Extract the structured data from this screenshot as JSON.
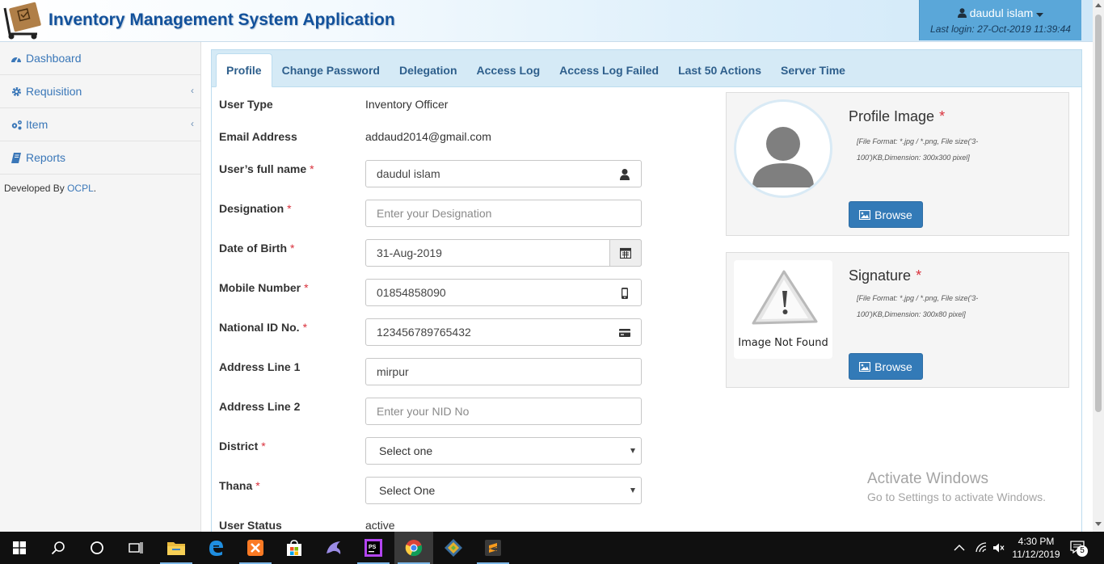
{
  "header": {
    "app_title": "Inventory Management System Application",
    "user_name": "daudul islam",
    "last_login": "Last login: 27-Oct-2019 11:39:44"
  },
  "sidebar": {
    "items": [
      {
        "label": "Dashboard",
        "icon": "dashboard-icon"
      },
      {
        "label": "Requisition",
        "icon": "gear-icon"
      },
      {
        "label": "Item",
        "icon": "gears-icon"
      },
      {
        "label": "Reports",
        "icon": "book-icon"
      }
    ],
    "developed_by_prefix": "Developed By",
    "developed_by_link": "OCPL",
    "developed_by_suffix": "."
  },
  "tabs": [
    {
      "label": "Profile",
      "active": true
    },
    {
      "label": "Change Password"
    },
    {
      "label": "Delegation"
    },
    {
      "label": "Access Log"
    },
    {
      "label": "Access Log Failed"
    },
    {
      "label": "Last 50 Actions"
    },
    {
      "label": "Server Time"
    }
  ],
  "form": {
    "user_type": {
      "label": "User Type",
      "value": "Inventory Officer"
    },
    "email": {
      "label": "Email Address",
      "value": "addaud2014@gmail.com"
    },
    "full_name": {
      "label": "User’s full name",
      "value": "daudul islam"
    },
    "designation": {
      "label": "Designation",
      "placeholder": "Enter your Designation"
    },
    "dob": {
      "label": "Date of Birth",
      "value": "31-Aug-2019"
    },
    "mobile": {
      "label": "Mobile Number",
      "value": "01854858090"
    },
    "nid": {
      "label": "National ID No.",
      "value": "123456789765432"
    },
    "address1": {
      "label": "Address Line 1",
      "value": "mirpur"
    },
    "address2": {
      "label": "Address Line 2",
      "placeholder": "Enter your NID No"
    },
    "district": {
      "label": "District",
      "selected": "Select one"
    },
    "thana": {
      "label": "Thana",
      "selected": "Select One"
    },
    "status": {
      "label": "User Status",
      "value": "active"
    },
    "required_mark": "*"
  },
  "profile_image": {
    "title": "Profile Image",
    "note": "[File Format: *.jpg / *.png, File size('3-100')KB,Dimension: 300x300 pixel]",
    "browse_label": "Browse"
  },
  "signature": {
    "title": "Signature",
    "note": "[File Format: *.jpg / *.png, File size('3-100')KB,Dimension: 300x80 pixel]",
    "browse_label": "Browse",
    "placeholder_text": "Image Not Found"
  },
  "watermark": {
    "line1": "Activate Windows",
    "line2": "Go to Settings to activate Windows."
  },
  "taskbar": {
    "time": "4:30 PM",
    "date": "11/12/2019",
    "notification_count": "5"
  },
  "colors": {
    "brand_blue": "#12519b",
    "header_user_bg": "#5aa7d9",
    "button_primary": "#337ab7",
    "required_red": "#d9303b"
  }
}
